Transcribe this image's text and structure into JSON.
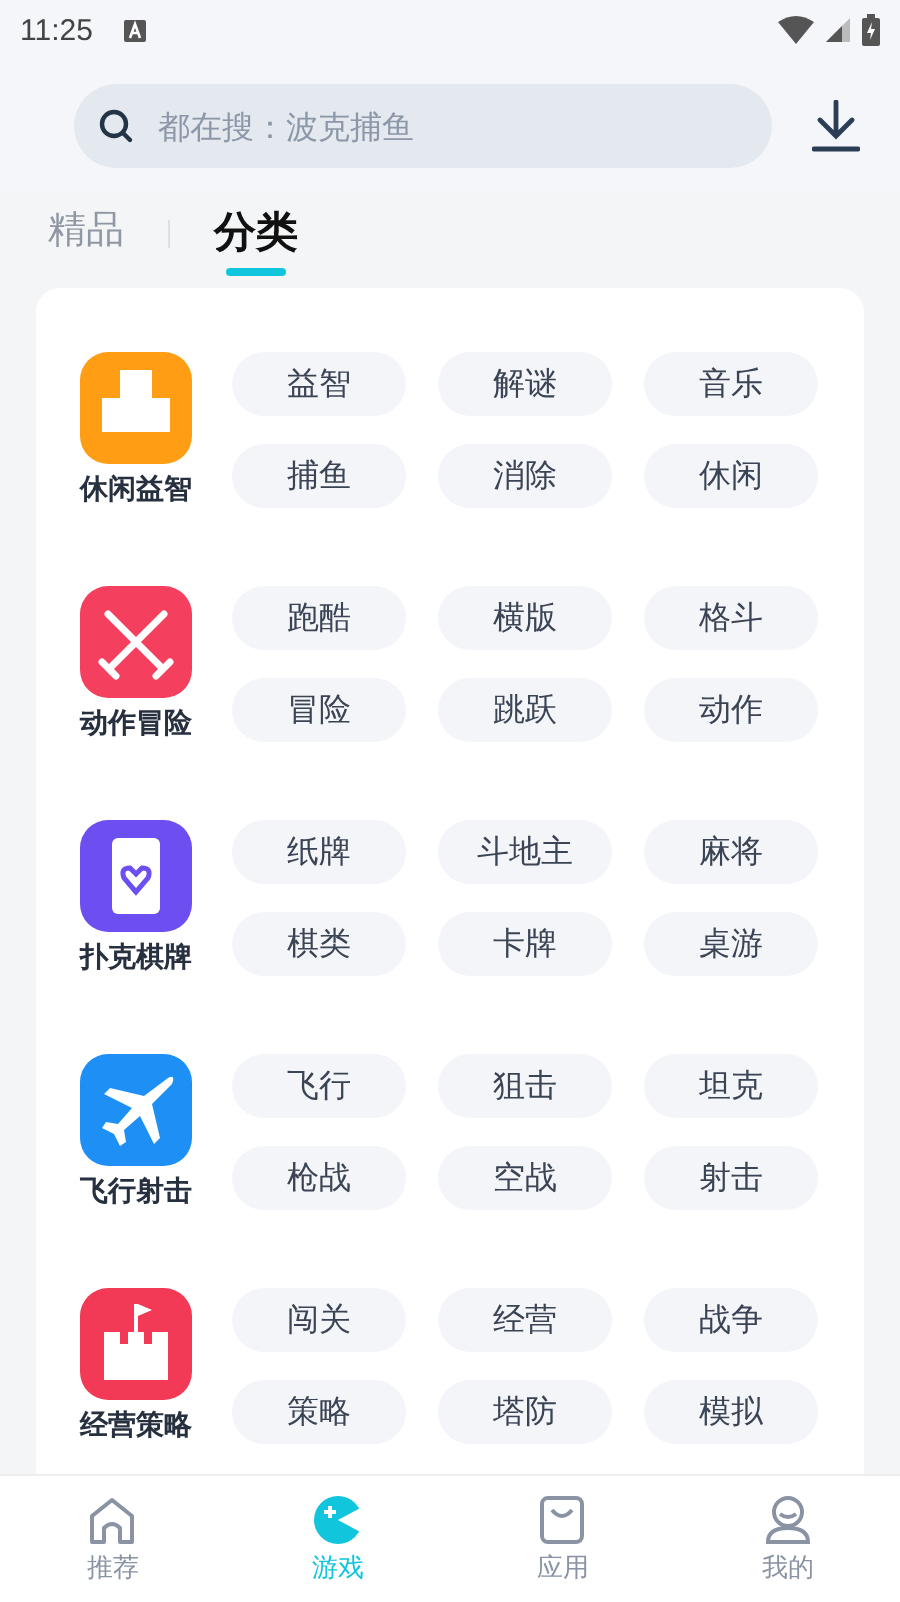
{
  "status_bar": {
    "time": "11:25"
  },
  "search": {
    "placeholder": "都在搜：波克捕鱼"
  },
  "tabs": [
    {
      "label": "精品",
      "selected": false
    },
    {
      "label": "分类",
      "selected": true
    }
  ],
  "categories": [
    {
      "name": "休闲益智",
      "color": "#ff9d14",
      "tags": [
        "益智",
        "解谜",
        "音乐",
        "捕鱼",
        "消除",
        "休闲"
      ]
    },
    {
      "name": "动作冒险",
      "color": "#f43f5e",
      "tags": [
        "跑酷",
        "横版",
        "格斗",
        "冒险",
        "跳跃",
        "动作"
      ]
    },
    {
      "name": "扑克棋牌",
      "color": "#6d4ef0",
      "tags": [
        "纸牌",
        "斗地主",
        "麻将",
        "棋类",
        "卡牌",
        "桌游"
      ]
    },
    {
      "name": "飞行射击",
      "color": "#1e8ff5",
      "tags": [
        "飞行",
        "狙击",
        "坦克",
        "枪战",
        "空战",
        "射击"
      ]
    },
    {
      "name": "经营策略",
      "color": "#f23a56",
      "tags": [
        "闯关",
        "经营",
        "战争",
        "策略",
        "塔防",
        "模拟"
      ]
    }
  ],
  "bottom_nav": [
    {
      "label": "推荐",
      "selected": false
    },
    {
      "label": "游戏",
      "selected": true
    },
    {
      "label": "应用",
      "selected": false
    },
    {
      "label": "我的",
      "selected": false
    }
  ]
}
